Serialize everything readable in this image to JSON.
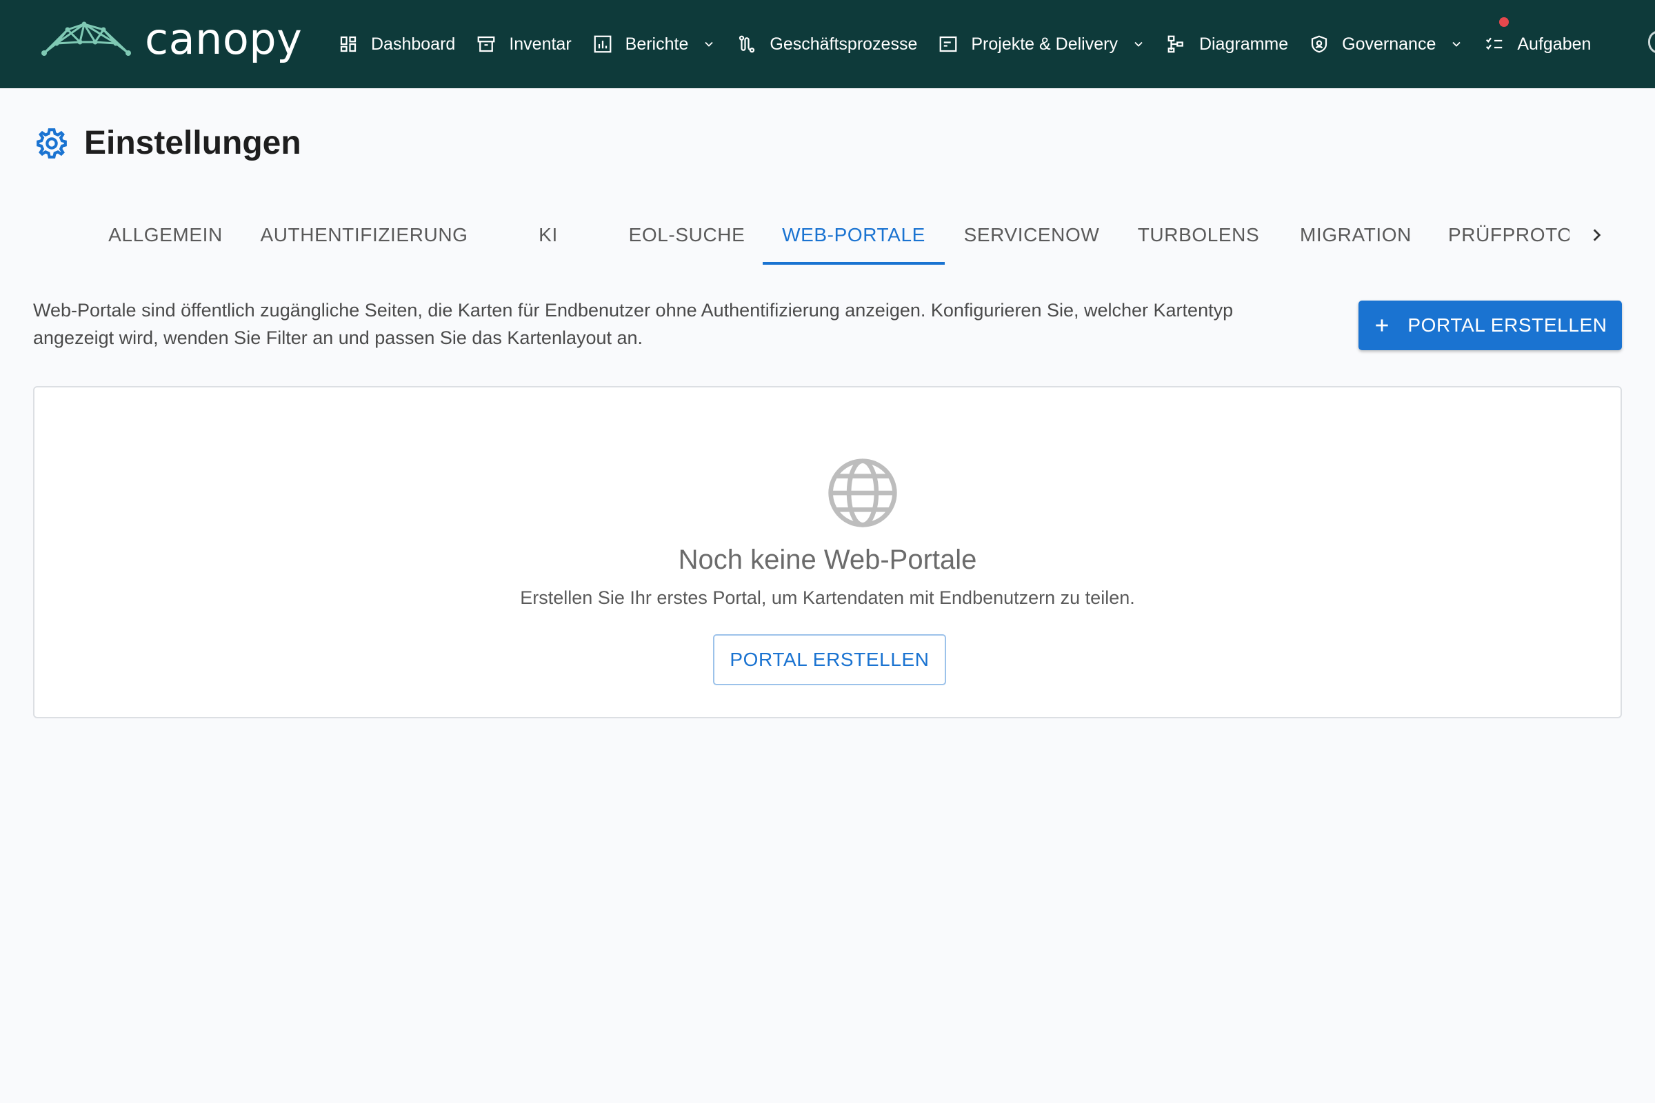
{
  "app": {
    "logo_text": "canopy",
    "nav": [
      {
        "label": "Dashboard",
        "icon": "dashboard-icon"
      },
      {
        "label": "Inventar",
        "icon": "archive-icon"
      },
      {
        "label": "Berichte",
        "icon": "bar-chart-icon",
        "has_dropdown": true
      },
      {
        "label": "Geschäftsprozesse",
        "icon": "process-icon"
      },
      {
        "label": "Projekte & Delivery",
        "icon": "project-icon",
        "has_dropdown": true
      },
      {
        "label": "Diagramme",
        "icon": "diagram-icon"
      },
      {
        "label": "Governance",
        "icon": "shield-icon",
        "has_dropdown": true
      },
      {
        "label": "Aufgaben",
        "icon": "checklist-icon",
        "notification": true
      }
    ]
  },
  "page": {
    "title": "Einstellungen",
    "icon": "gear-icon"
  },
  "tabs": {
    "items": [
      "ALLGEMEIN",
      "AUTHENTIFIZIERUNG",
      "KI",
      "EOL-SUCHE",
      "WEB-PORTALE",
      "SERVICENOW",
      "TURBOLENS",
      "MIGRATION",
      "PRÜFPROTOKOLL"
    ],
    "active": "WEB-PORTALE"
  },
  "web_portals": {
    "description": "Web-Portale sind öffentlich zugängliche Seiten, die Karten für Endbenutzer ohne Authentifizierung anzeigen. Konfigurieren Sie, welcher Kartentyp angezeigt wird, wenden Sie Filter an und passen Sie das Kartenlayout an.",
    "create_button": "PORTAL ERSTELLEN",
    "empty_state": {
      "title": "Noch keine Web-Portale",
      "subtitle": "Erstellen Sie Ihr erstes Portal, um Kartendaten mit Endbenutzern zu teilen.",
      "button": "PORTAL ERSTELLEN"
    }
  },
  "colors": {
    "topbar": "#0e3a3a",
    "accent": "#1a73d1",
    "notification": "#e5484d"
  }
}
